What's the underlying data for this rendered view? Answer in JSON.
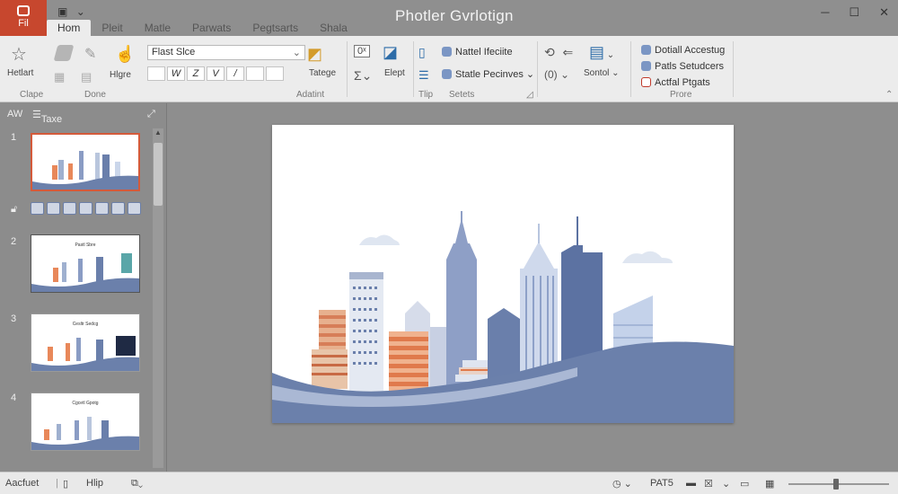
{
  "window": {
    "title": "Photler Gvrlotign"
  },
  "file_tab": {
    "label": "Fil"
  },
  "tabs": [
    {
      "label": "Hom",
      "active": true
    },
    {
      "label": "Pleit"
    },
    {
      "label": "Matle"
    },
    {
      "label": "Parwats"
    },
    {
      "label": "Pegtsarts"
    },
    {
      "label": "Shala"
    }
  ],
  "ribbon": {
    "clipboard": {
      "btn_label": "Hetlart",
      "group_label": "Clape"
    },
    "done": {
      "group_label": "Done",
      "btn_label": "Hlgre"
    },
    "font": {
      "value": "Flast Slce",
      "group_label": "Adatint"
    },
    "format": {
      "buttons": [
        "",
        "W",
        "Z",
        "V",
        "/",
        "",
        ""
      ]
    },
    "arrange": {
      "btn1": "Tatege",
      "btn2": "Elept"
    },
    "tip": {
      "group_label": "Tlip"
    },
    "sets": {
      "item1": "Nattel Ifeciite",
      "item2": "Statle Pecinves",
      "group_label": "Setets"
    },
    "sontol": {
      "btn_label": "Sontol"
    },
    "prore": {
      "item1": "Dotiall Accestug",
      "item2": "Patls Setudcers",
      "item3": "Actfal Ptgats",
      "group_label": "Prore"
    }
  },
  "sidebar": {
    "head_left": "AW",
    "head_tab": "Taxe",
    "slides": [
      {
        "num": "1",
        "caption": "",
        "selected": true
      },
      {
        "num": "2",
        "caption": "Pastl Sbre",
        "selected": false
      },
      {
        "num": "3",
        "caption": "Cesltr Sedcg",
        "selected": false
      },
      {
        "num": "4",
        "caption": "Cgcetl Gpotg",
        "selected": false
      }
    ]
  },
  "status": {
    "left1": "Aacfuet",
    "left2": "Hlip",
    "right_text": "PAT5"
  },
  "colors": {
    "file_tab": "#c7472e",
    "slide_building_blue": "#6a7fab",
    "slide_building_orange": "#e8885a",
    "slide_hill": "#6b80ab"
  }
}
